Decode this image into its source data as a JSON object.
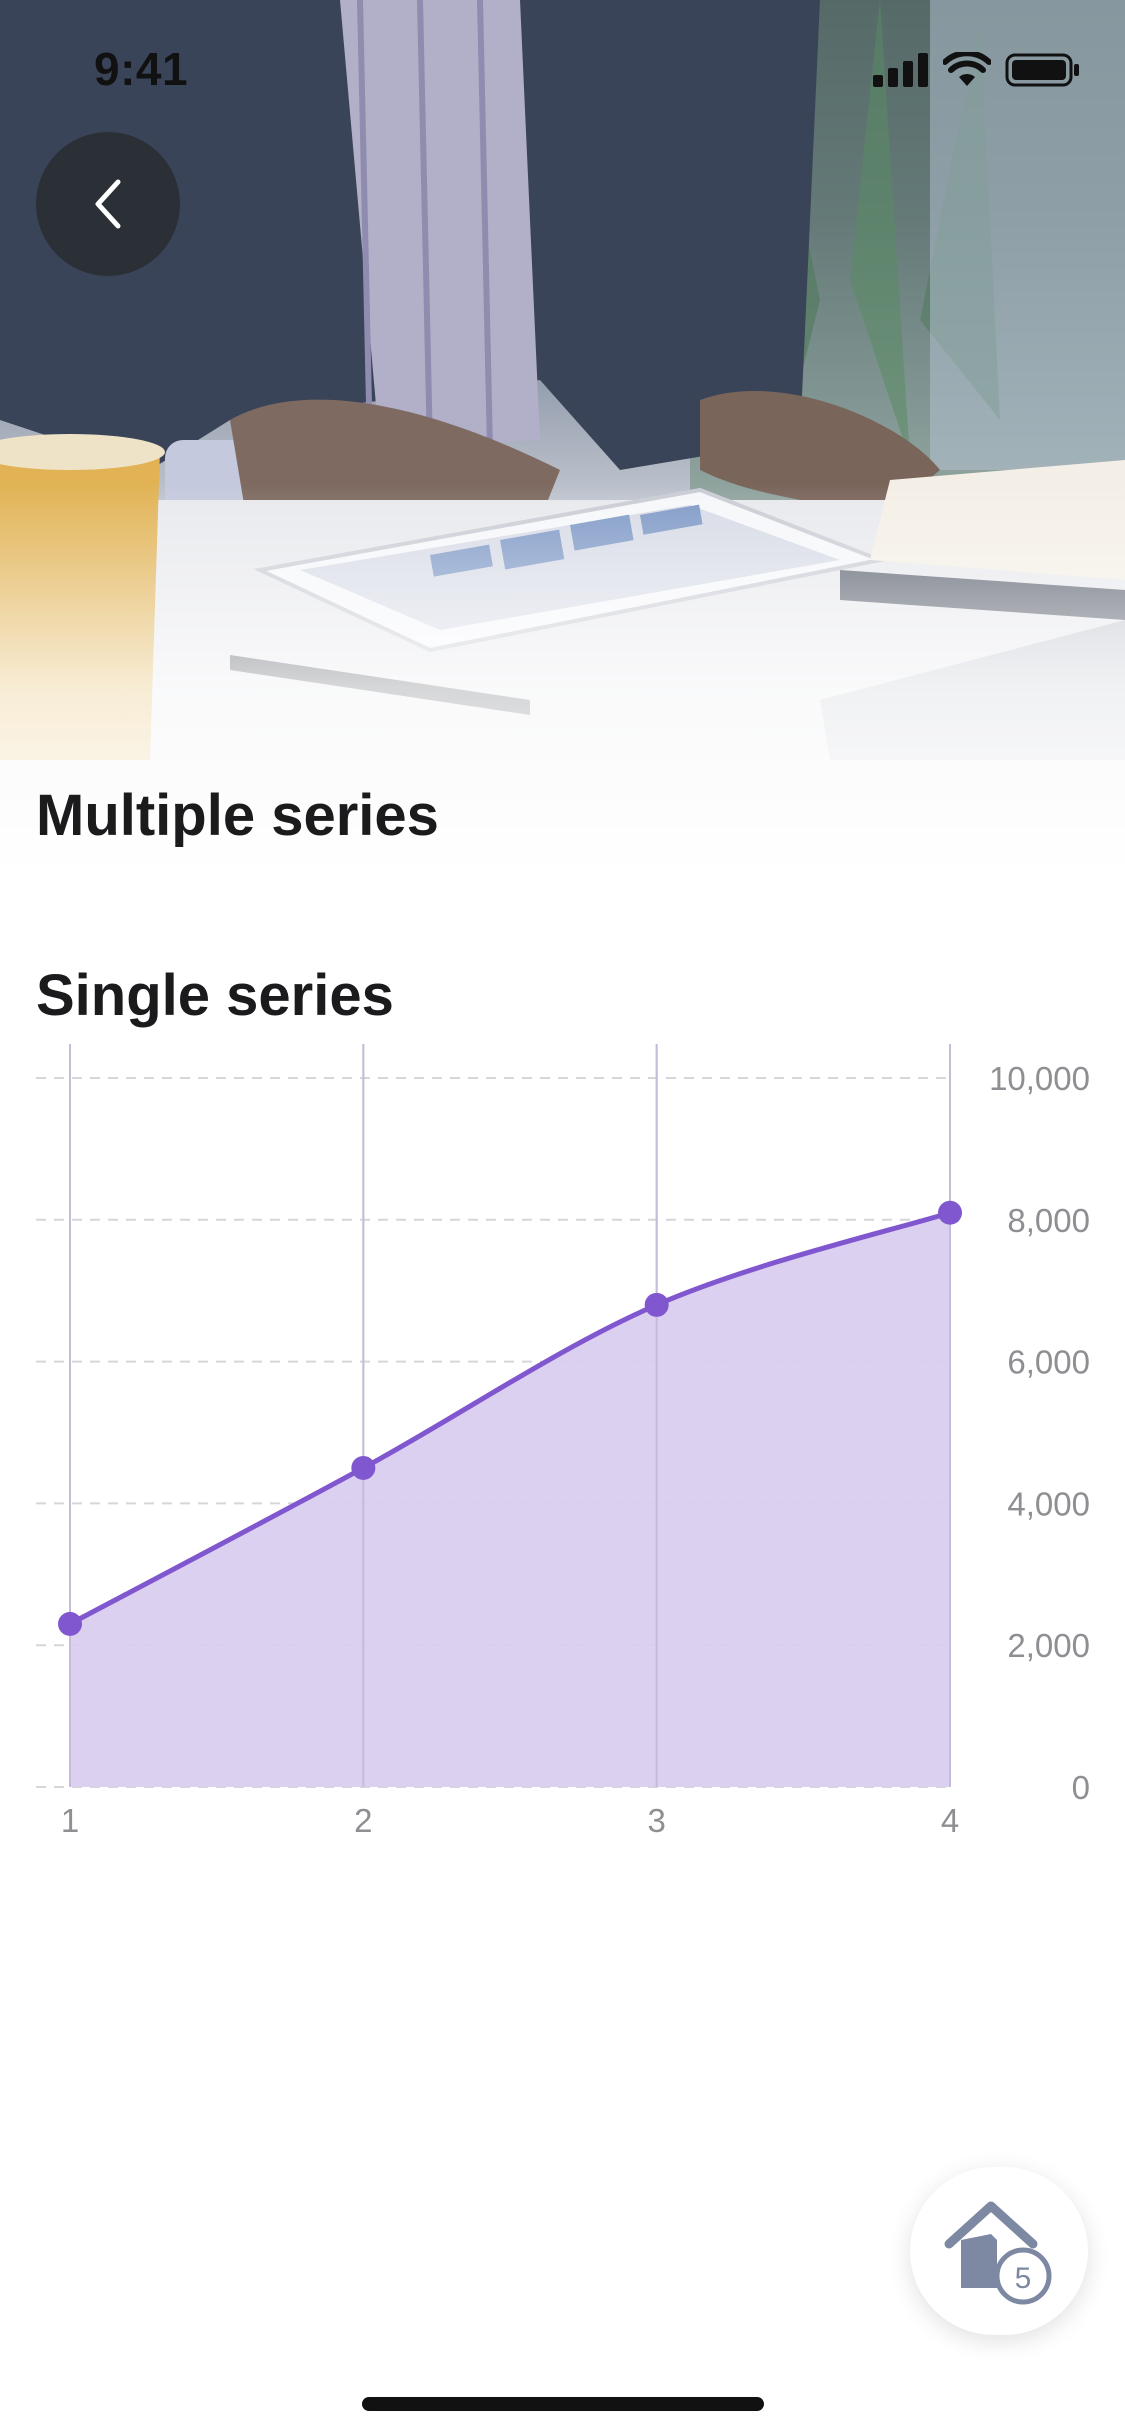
{
  "status_bar": {
    "time": "9:41"
  },
  "header": {
    "title": "Multiple series"
  },
  "section": {
    "title": "Single series"
  },
  "chart_data": {
    "type": "area",
    "x": [
      1,
      2,
      3,
      4
    ],
    "values": [
      2300,
      4500,
      6800,
      8100
    ],
    "x_tick_labels": [
      "1",
      "2",
      "3",
      "4"
    ],
    "y_tick_labels": [
      "0",
      "2,000",
      "4,000",
      "6,000",
      "8,000",
      "10,000"
    ],
    "y_ticks": [
      0,
      2000,
      4000,
      6000,
      8000,
      10000
    ],
    "ylim": [
      0,
      10000
    ],
    "grid": true,
    "y_axis_position": "right",
    "line_color": "#8057cf",
    "fill_color": "#d9cdef"
  },
  "fab": {
    "icon": "home-icon",
    "badge": "5"
  },
  "colors": {
    "accent": "#8057cf"
  }
}
